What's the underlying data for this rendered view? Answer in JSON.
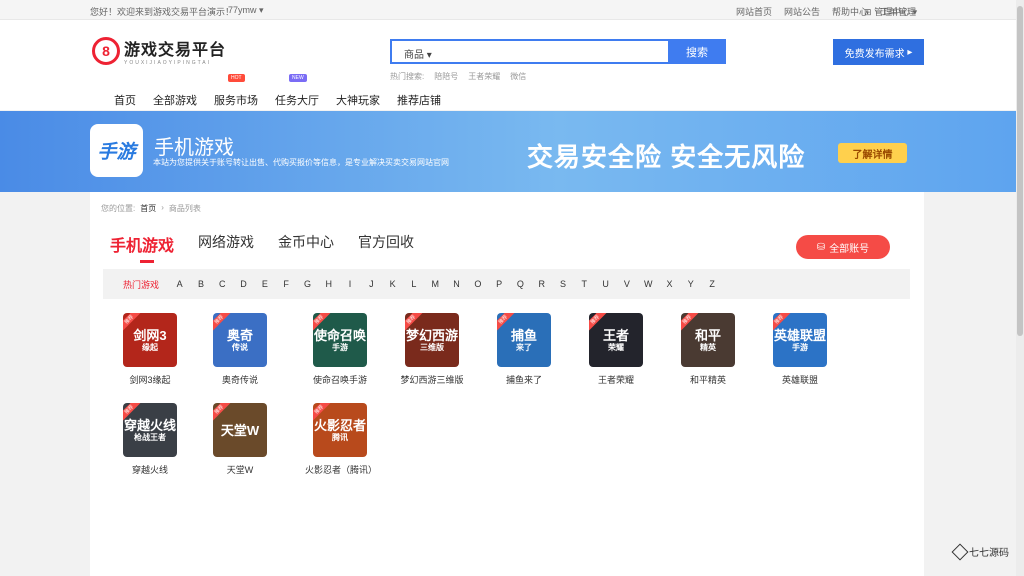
{
  "topbar": {
    "greeting": "您好！欢迎来到游戏交易平台演示！",
    "username": "77ymw",
    "links": [
      "网站首页",
      "网站公告",
      "帮助中心",
      "工单管理"
    ],
    "manage": "管理中心"
  },
  "header": {
    "logo_title": "游戏交易平台",
    "logo_sub": "YOUXIJIAOYIPINGTAI",
    "search_category": "商品",
    "search_button": "搜索",
    "hot_label": "热门搜索:",
    "hot_terms": [
      "陪陪号",
      "王者荣耀",
      "微信"
    ],
    "publish_button": "免费发布需求"
  },
  "nav": {
    "items": [
      "首页",
      "全部游戏",
      "服务市场",
      "任务大厅",
      "大神玩家",
      "推荐店铺"
    ],
    "hot_badge": "HOT",
    "new_badge": "NEW"
  },
  "banner": {
    "icon_text": "手游",
    "title": "手机游戏",
    "desc": "本站为您提供关于账号转让出售、代购买报价等信息，是专业解决买卖交易网站官网",
    "slogan": "交易安全险 安全无风险",
    "detail_button": "了解详情"
  },
  "main": {
    "crumb_label": "您的位置:",
    "crumb_home": "首页",
    "crumb_current": "商品列表",
    "tabs": [
      "手机游戏",
      "网络游戏",
      "金币中心",
      "官方回收"
    ],
    "all_accounts": "全部账号",
    "hot_games": "热门游戏",
    "letters": [
      "A",
      "B",
      "C",
      "D",
      "E",
      "F",
      "G",
      "H",
      "I",
      "J",
      "K",
      "L",
      "M",
      "N",
      "O",
      "P",
      "Q",
      "R",
      "S",
      "T",
      "U",
      "V",
      "W",
      "X",
      "Y",
      "Z"
    ],
    "tag": "推荐",
    "games": [
      {
        "name": "剑网3缘起",
        "t1": "剑网3",
        "t2": "缘起",
        "color": "#b3261b"
      },
      {
        "name": "奥奇传说",
        "t1": "奥奇",
        "t2": "传说",
        "color": "#3b6fc4"
      },
      {
        "name": "使命召唤手游",
        "t1": "使命召唤",
        "t2": "手游",
        "color": "#1f5a4a"
      },
      {
        "name": "梦幻西游三维版",
        "t1": "梦幻西游",
        "t2": "三维版",
        "color": "#7a2a1c"
      },
      {
        "name": "捕鱼来了",
        "t1": "捕鱼",
        "t2": "来了",
        "color": "#2a6fb8"
      },
      {
        "name": "王者荣耀",
        "t1": "王者",
        "t2": "荣耀",
        "color": "#23242c"
      },
      {
        "name": "和平精英",
        "t1": "和平",
        "t2": "精英",
        "color": "#4a3a32"
      },
      {
        "name": "英雄联盟",
        "t1": "英雄联盟",
        "t2": "手游",
        "color": "#2c73c6"
      },
      {
        "name": "穿越火线",
        "t1": "穿越火线",
        "t2": "枪战王者",
        "color": "#3a3f46"
      },
      {
        "name": "天堂W",
        "t1": "天堂W",
        "t2": "",
        "color": "#6a4a2a"
      },
      {
        "name": "火影忍者（腾讯）",
        "t1": "火影忍者",
        "t2": "腾讯",
        "color": "#b84a1c"
      }
    ]
  },
  "watermark": "七七源码"
}
